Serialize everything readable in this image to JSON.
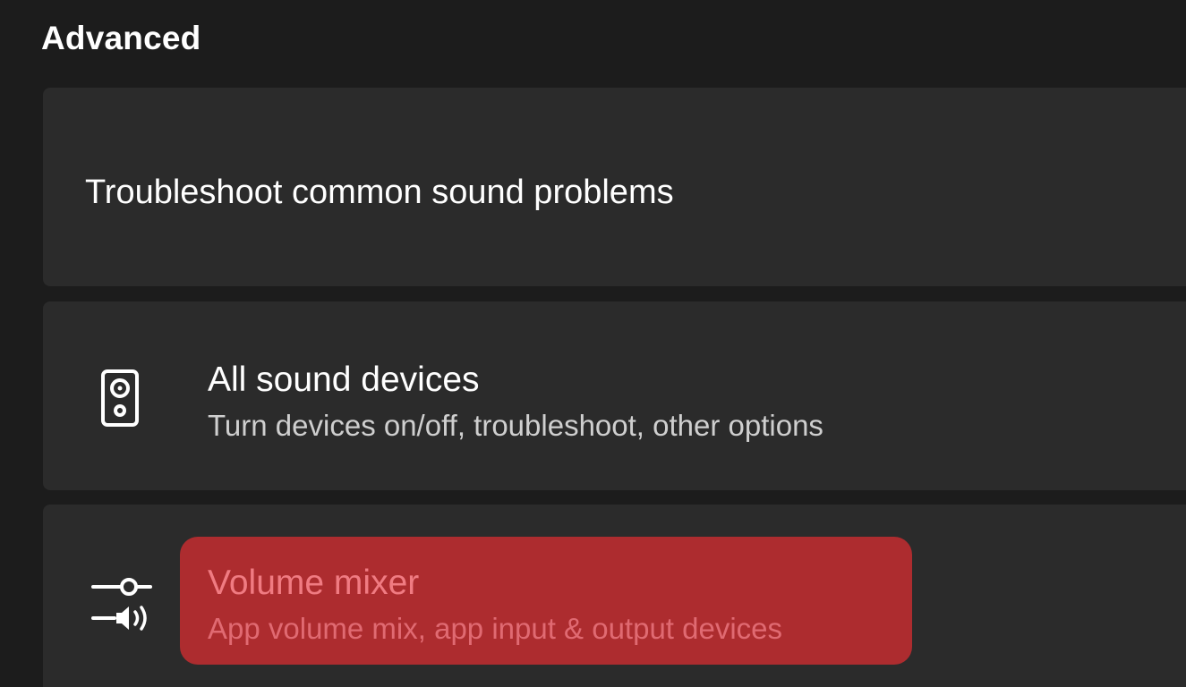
{
  "section": {
    "title": "Advanced"
  },
  "rows": {
    "troubleshoot": {
      "label": "Troubleshoot common sound problems"
    },
    "all_devices": {
      "title": "All sound devices",
      "subtitle": "Turn devices on/off, troubleshoot, other options",
      "icon": "speaker-icon"
    },
    "volume_mixer": {
      "title": "Volume mixer",
      "subtitle": "App volume mix, app input & output devices",
      "icon": "volume-mixer-icon",
      "highlighted": true
    }
  },
  "colors": {
    "background": "#1c1c1c",
    "card": "#2b2b2b",
    "highlight": "#ad2c2f",
    "highlight_text": "#f07b82"
  }
}
